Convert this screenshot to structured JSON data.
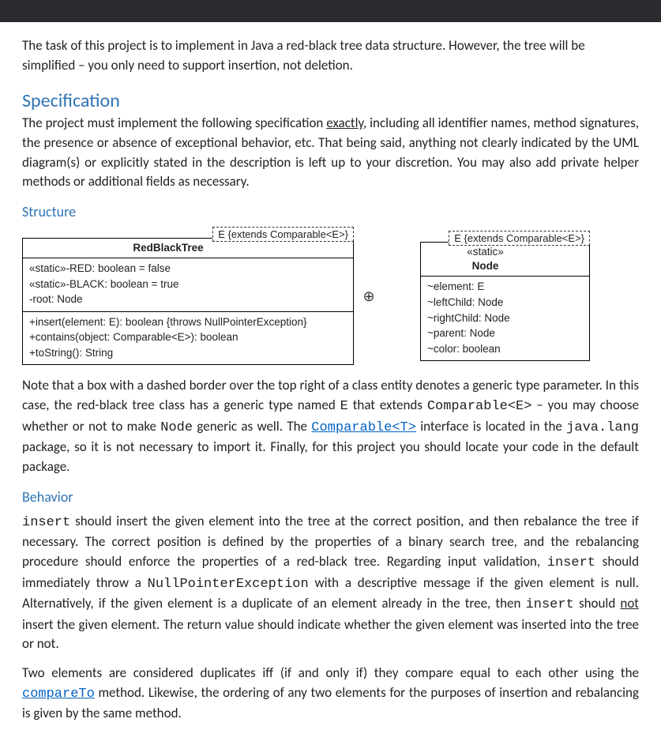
{
  "intro": "The task of this project is to implement in Java a red-black tree data structure.  However, the tree will be simplified – you only need to support insertion, not deletion.",
  "spec_heading": "Specification",
  "spec_para_pre": "The project must implement the following specification ",
  "spec_para_underline": "exactly",
  "spec_para_post": ", including all identifier names, method signatures, the presence or absence of exceptional behavior, etc.  That being said, anything not clearly indicated by the UML diagram(s) or explicitly stated in the description is left up to your discretion.  You may also add private helper methods or additional fields as necessary.",
  "structure_heading": "Structure",
  "uml": {
    "left": {
      "generic": "E {extends Comparable<E>}",
      "name": "RedBlackTree",
      "attrs": [
        "«static»-RED: boolean = false",
        "«static»-BLACK: boolean = true",
        "-root: Node"
      ],
      "ops": [
        "+insert(element: E): boolean {throws NullPointerException}",
        "+contains(object: Comparable<E>): boolean",
        "+toString(): String"
      ]
    },
    "connector": "⊕",
    "right": {
      "generic": "E {extends Comparable<E>}",
      "stereotype": "«static»",
      "name": "Node",
      "attrs": [
        "~element: E",
        "~leftChild: Node",
        "~rightChild: Node",
        "~parent: Node",
        "~color: boolean"
      ]
    }
  },
  "note_p1_a": "Note that a box with a dashed border over the top right of a class entity denotes a generic type parameter.  In this case, the red-black tree class has a generic type named ",
  "note_E": "E",
  "note_p1_b": " that extends ",
  "note_comp": "Comparable<E>",
  "note_p1_c": " – you may choose whether or not to make ",
  "note_node": "Node",
  "note_p1_d": " generic as well.  The ",
  "note_link1": "Comparable<T>",
  "note_p1_e": " interface is located in the ",
  "note_pkg": "java.lang",
  "note_p1_f": " package, so it is not necessary to import it.  Finally, for this project you should locate your code in the default package.",
  "behavior_heading": "Behavior",
  "beh_insert": "insert",
  "beh_p1_a": " should insert the given element into the tree at the correct position, and then rebalance the tree if necessary.  The correct position is defined by the properties of a binary search tree, and the rebalancing procedure should enforce the properties of a red-black tree.  Regarding input validation, ",
  "beh_p1_b": " should immediately throw a ",
  "beh_npe": "NullPointerException",
  "beh_p1_c": " with a descriptive message if the given element is null.  Alternatively, if the given element is a duplicate of an element already in the tree, then ",
  "beh_p1_d": " should ",
  "beh_not": "not",
  "beh_p1_e": " insert the given element.  The return value should indicate whether the given element was inserted into the tree or not.",
  "beh_p2_a": "Two elements are considered duplicates iff (if and only if) they compare equal to each other using the ",
  "beh_link2": "compareTo",
  "beh_p2_b": " method.  Likewise, the ordering of any two elements for the purposes of insertion and rebalancing is given by the same method."
}
